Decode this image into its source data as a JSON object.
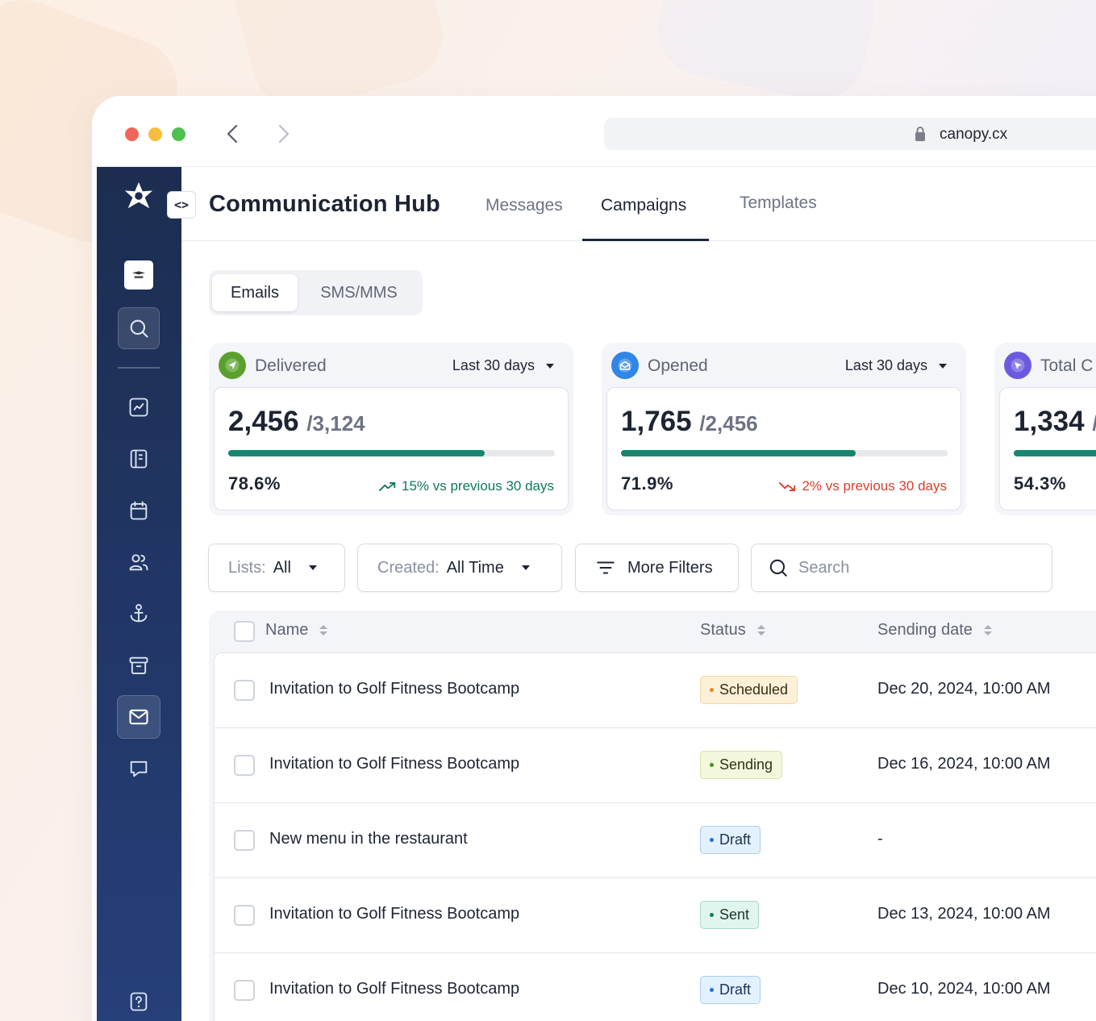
{
  "browser": {
    "url": "canopy.cx"
  },
  "app": {
    "title": "Communication Hub",
    "collapse_glyph": "<>",
    "tabs": [
      {
        "label": "Messages",
        "active": false
      },
      {
        "label": "Campaigns",
        "active": true
      },
      {
        "label": "Templates",
        "active": false
      }
    ]
  },
  "sidebar": {
    "items": [
      "logo-icon",
      "workspace-avatar",
      "search-icon",
      "analytics-icon",
      "notebook-icon",
      "calendar-icon",
      "users-icon",
      "anchor-icon",
      "archive-icon",
      "mail-icon",
      "chat-icon",
      "help-icon"
    ],
    "active": "mail-icon"
  },
  "channel_toggle": {
    "options": [
      "Emails",
      "SMS/MMS"
    ],
    "selected": "Emails"
  },
  "stats": [
    {
      "label": "Delivered",
      "range": "Last 30 days",
      "value": "2,456",
      "total": "/3,124",
      "percent": "78.6%",
      "progress": 0.786,
      "trend": "15% vs previous 30 days",
      "trend_dir": "up",
      "icon": "send-icon",
      "icon_color": "#5aa02c"
    },
    {
      "label": "Opened",
      "range": "Last 30 days",
      "value": "1,765",
      "total": "/2,456",
      "percent": "71.9%",
      "progress": 0.719,
      "trend": "2% vs previous 30 days",
      "trend_dir": "down",
      "icon": "open-mail-icon",
      "icon_color": "#2f86e6"
    },
    {
      "label": "Total C",
      "value": "1,334",
      "total": "/",
      "percent": "54.3%",
      "progress": 0.543,
      "icon": "click-icon",
      "icon_color": "#6a5ae0"
    }
  ],
  "filters": {
    "lists": {
      "label": "Lists:",
      "value": "All"
    },
    "created": {
      "label": "Created:",
      "value": "All Time"
    },
    "more": "More Filters",
    "search_placeholder": "Search"
  },
  "table": {
    "columns": [
      "Name",
      "Status",
      "Sending date"
    ],
    "rows": [
      {
        "name": "Invitation to Golf Fitness Bootcamp",
        "status": "Scheduled",
        "date": "Dec 20, 2024, 10:00 AM"
      },
      {
        "name": "Invitation to Golf Fitness Bootcamp",
        "status": "Sending",
        "date": "Dec 16, 2024, 10:00 AM"
      },
      {
        "name": "New menu in the restaurant",
        "status": "Draft",
        "date": "-"
      },
      {
        "name": "Invitation to Golf Fitness Bootcamp",
        "status": "Sent",
        "date": "Dec 13, 2024, 10:00 AM"
      },
      {
        "name": "Invitation to Golf Fitness Bootcamp",
        "status": "Draft",
        "date": "Dec 10, 2024, 10:00 AM"
      }
    ]
  }
}
